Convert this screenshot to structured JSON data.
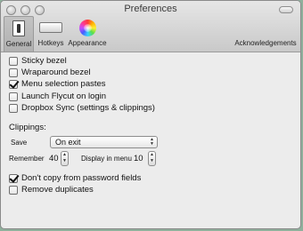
{
  "window": {
    "title": "Preferences"
  },
  "toolbar": {
    "general": "General",
    "hotkeys": "Hotkeys",
    "appearance": "Appearance",
    "acknowledgements": "Acknowledgements"
  },
  "options": [
    {
      "label": "Sticky bezel",
      "checked": false
    },
    {
      "label": "Wraparound bezel",
      "checked": false
    },
    {
      "label": "Menu selection pastes",
      "checked": true
    },
    {
      "label": "Launch Flycut on login",
      "checked": false
    },
    {
      "label": "Dropbox Sync (settings & clippings)",
      "checked": false
    }
  ],
  "clippings": {
    "heading": "Clippings:",
    "save_label": "Save",
    "save_value": "On exit",
    "remember_label": "Remember",
    "remember_value": "40",
    "display_label": "Display in menu",
    "display_value": "10"
  },
  "bottom_options": [
    {
      "label": "Don't copy from password fields",
      "checked": true
    },
    {
      "label": "Remove duplicates",
      "checked": false
    }
  ]
}
